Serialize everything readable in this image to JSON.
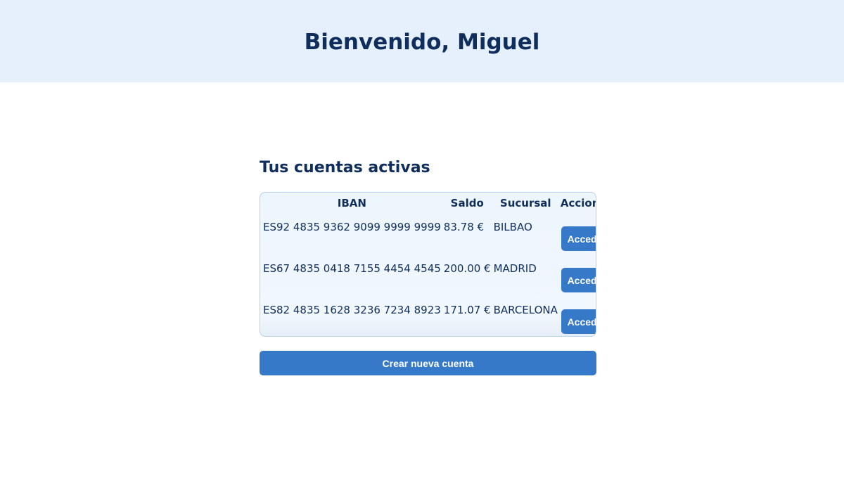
{
  "header": {
    "title": "Bienvenido, Miguel"
  },
  "accounts": {
    "title": "Tus cuentas activas",
    "columns": {
      "iban": "IBAN",
      "saldo": "Saldo",
      "sucursal": "Sucursal",
      "acciones": "Acciones"
    },
    "rows": [
      {
        "iban": "ES92 4835 9362 9099 9999 9999",
        "saldo": "83.78 €",
        "sucursal": "BILBAO",
        "action_label": "Acceder"
      },
      {
        "iban": "ES67 4835 0418 7155 4454 4545",
        "saldo": "200.00 €",
        "sucursal": "MADRID",
        "action_label": "Acceder"
      },
      {
        "iban": "ES82 4835 1628 3236 7234 8923",
        "saldo": "171.07 €",
        "sucursal": "BARCELONA",
        "action_label": "Acceder"
      }
    ],
    "create_label": "Crear nueva cuenta"
  },
  "colors": {
    "header_bg": "#e6f0fd",
    "primary_text": "#0f2e5c",
    "button_bg": "#3679c8",
    "table_bg": "#eef5fd",
    "table_border": "#b9cfe8"
  }
}
